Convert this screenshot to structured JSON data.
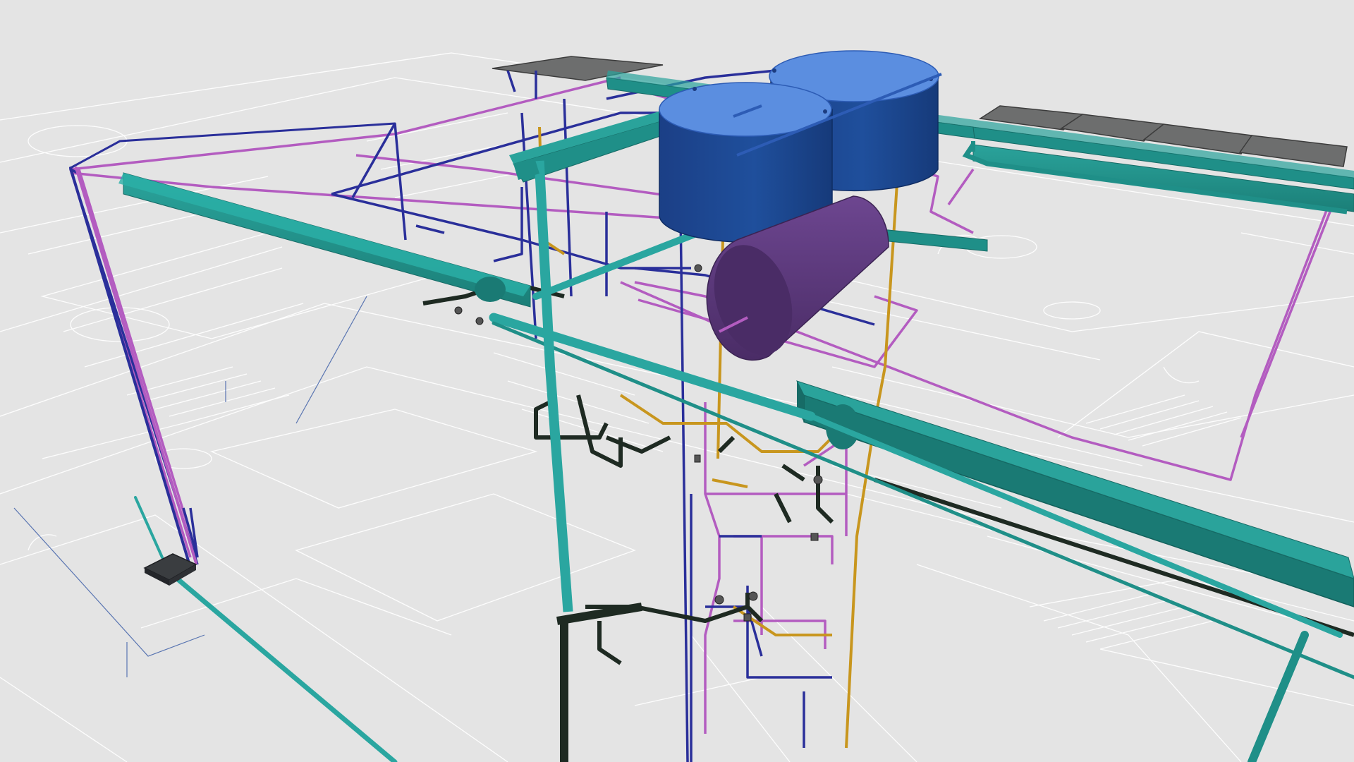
{
  "scene": {
    "kind": "3d-plumbing-model-view",
    "background_color": "#e4e4e4",
    "floor_plan_color": "#ffffff",
    "colors": {
      "water_tank": "#1f4f9c",
      "water_tank_top": "#5b8ee0",
      "hot_water_cylinder": "#5a3878",
      "rain_gutter": "#1f8f88",
      "cold_water_pipe": "#2a2f9a",
      "hot_water_pipe": "#b35cc0",
      "gas_pipe": "#c8961e",
      "sewer_pipe": "#1e2a22",
      "downpipe": "#2aa6a0",
      "solar_panel": "#6d6e6e"
    },
    "objects": {
      "water_tanks": "water-tank-icon",
      "hot_water_cylinder": "boiler-icon",
      "solar_panels": "solar-panel-icon",
      "rain_gutters": "gutter-icon"
    }
  }
}
